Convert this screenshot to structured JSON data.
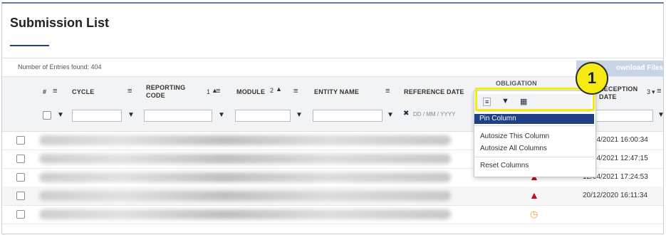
{
  "page": {
    "title": "Submission List"
  },
  "toolbar": {
    "entries_label": "Number of Entries found: 404",
    "download_label": "ownload Files"
  },
  "columns": {
    "num": "#",
    "cycle": "CYCLE",
    "reporting_code": "REPORTING CODE",
    "reporting_code_sort": "1",
    "module": "MODULE",
    "module_sort": "2",
    "entity_name": "ENTITY NAME",
    "reference_date": "REFERENCE DATE",
    "reference_date_placeholder": "DD / MM / YYYY",
    "obligation": "OBLIGATION",
    "reception": "RECEPTION DATE",
    "reception_sort": "3"
  },
  "rows": [
    {
      "status": "",
      "date": "20/04/2021 16:00:34"
    },
    {
      "status": "",
      "date": "20/04/2021 12:47:15"
    },
    {
      "status": "warning-icon",
      "date": "12/04/2021 17:24:53"
    },
    {
      "status": "warning-icon",
      "date": "20/12/2020 16:11:34"
    },
    {
      "status": "clock-icon",
      "date": ""
    }
  ],
  "column_menu": {
    "pin": "Pin Column",
    "autosize_this": "Autosize This Column",
    "autosize_all": "Autosize All Columns",
    "reset": "Reset Columns"
  },
  "callout": {
    "number": "1"
  },
  "colors": {
    "accent": "#1f3f86",
    "highlight": "#f5ea14",
    "warning": "#d0021b",
    "pending": "#f5a623"
  }
}
